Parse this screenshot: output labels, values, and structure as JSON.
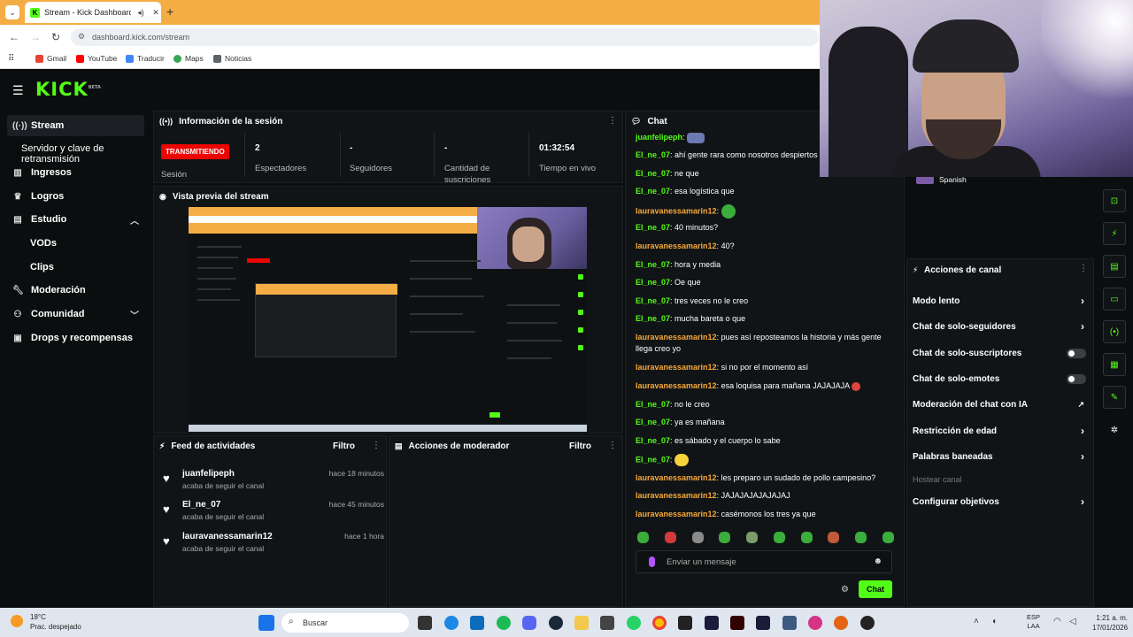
{
  "browser": {
    "tab_title": "Stream - Kick Dashboard",
    "url": "dashboard.kick.com/stream",
    "bookmarks": [
      "Gmail",
      "YouTube",
      "Traducir",
      "Maps",
      "Noticias"
    ]
  },
  "app": {
    "logo": "KICK",
    "logo_sup": "BETA"
  },
  "sidebar": {
    "items": [
      {
        "label": "Stream",
        "icon": "broadcast-icon"
      },
      {
        "label": "Servidor y clave de retransmisión"
      },
      {
        "label": "Ingresos",
        "icon": "chart-icon"
      },
      {
        "label": "Logros",
        "icon": "trophy-icon"
      },
      {
        "label": "Estudio",
        "icon": "studio-icon"
      },
      {
        "label": "VODs"
      },
      {
        "label": "Clips"
      },
      {
        "label": "Moderación",
        "icon": "wrench-icon"
      },
      {
        "label": "Comunidad",
        "icon": "people-icon"
      },
      {
        "label": "Drops y recompensas",
        "icon": "gift-icon"
      }
    ]
  },
  "session": {
    "title": "Información de la sesión",
    "status": "TRANSMITIENDO",
    "status_label": "Sesión",
    "viewers_value": "2",
    "viewers_label": "Espectadores",
    "followers_value": "-",
    "followers_label": "Seguidores",
    "subs_value": "-",
    "subs_label": "Cantidad de suscriciones",
    "time_value": "01:32:54",
    "time_label": "Tiempo en vivo"
  },
  "preview": {
    "title": "Vista previa del stream"
  },
  "feed": {
    "title": "Feed de actividades",
    "filter": "Filtro",
    "items": [
      {
        "name": "juanfelipeph",
        "action": "acaba de seguir el canal",
        "time": "hace 18 minutos"
      },
      {
        "name": "El_ne_07",
        "action": "acaba de seguir el canal",
        "time": "hace 45 minutos"
      },
      {
        "name": "lauravanessamarin12",
        "action": "acaba de seguir el canal",
        "time": "hace 1 hora"
      }
    ]
  },
  "mod_actions": {
    "title": "Acciones de moderador",
    "filter": "Filtro"
  },
  "chat": {
    "title": "Chat",
    "messages": [
      {
        "user": "juanfelipeph",
        "text": "",
        "color": "green"
      },
      {
        "user": "El_ne_07",
        "text": "ahí gente rara como nosotros despiertos",
        "color": "green"
      },
      {
        "user": "El_ne_07",
        "text": "ne que",
        "color": "green"
      },
      {
        "user": "El_ne_07",
        "text": "esa logística que",
        "color": "green"
      },
      {
        "user": "lauravanessamarin12",
        "text": "",
        "color": "orange"
      },
      {
        "user": "El_ne_07",
        "text": "40 minutos?",
        "color": "green"
      },
      {
        "user": "lauravanessamarin12",
        "text": "40?",
        "color": "orange"
      },
      {
        "user": "El_ne_07",
        "text": "hora y media",
        "color": "green"
      },
      {
        "user": "El_ne_07",
        "text": "Oe que",
        "color": "green"
      },
      {
        "user": "El_ne_07",
        "text": "tres veces no le creo",
        "color": "green"
      },
      {
        "user": "El_ne_07",
        "text": "mucha bareta o que",
        "color": "green"
      },
      {
        "user": "lauravanessamarin12",
        "text": "pues así reposteamos la historia y más gente llega creo yo",
        "color": "orange"
      },
      {
        "user": "lauravanessamarin12",
        "text": "si no por el momento así",
        "color": "orange"
      },
      {
        "user": "lauravanessamarin12",
        "text": "esa loquisa para mañana JAJAJAJA",
        "color": "orange"
      },
      {
        "user": "El_ne_07",
        "text": "no le creo",
        "color": "green"
      },
      {
        "user": "El_ne_07",
        "text": "ya es mañana",
        "color": "green"
      },
      {
        "user": "El_ne_07",
        "text": "es sábado y el cuerpo lo sabe",
        "color": "green"
      },
      {
        "user": "El_ne_07",
        "text": "",
        "color": "green"
      },
      {
        "user": "lauravanessamarin12",
        "text": "les preparo un sudado de pollo campesino?",
        "color": "orange"
      },
      {
        "user": "lauravanessamarin12",
        "text": "JAJAJAJAJAJAJAJ",
        "color": "orange"
      },
      {
        "user": "lauravanessamarin12",
        "text": "casémonos los tres ya que",
        "color": "orange"
      }
    ],
    "input_placeholder": "Enviar un mensaje",
    "send_label": "Chat"
  },
  "channel": {
    "language": "Spanish",
    "actions_title": "Acciones de canal",
    "actions": [
      {
        "label": "Modo lento",
        "control": "arrow"
      },
      {
        "label": "Chat de solo-seguidores",
        "control": "arrow"
      },
      {
        "label": "Chat de solo-suscriptores",
        "control": "toggle"
      },
      {
        "label": "Chat de solo-emotes",
        "control": "toggle"
      },
      {
        "label": "Moderación del chat con IA",
        "control": "external"
      },
      {
        "label": "Restricción de edad",
        "control": "arrow"
      },
      {
        "label": "Palabras baneadas",
        "control": "arrow"
      },
      {
        "label": "Hostear canal",
        "control": "none"
      },
      {
        "label": "Configurar objetivos",
        "control": "arrow"
      }
    ]
  },
  "taskbar": {
    "weather_temp": "18°C",
    "weather_desc": "Prac. despejado",
    "search": "Buscar",
    "lang_top": "ESP",
    "lang_bottom": "LAA",
    "time": "1:21 a. m.",
    "date": "17/01/2026"
  },
  "colors": {
    "kick_green": "#53fc18",
    "live_red": "#eb0400",
    "user_orange": "#f6a93b"
  }
}
